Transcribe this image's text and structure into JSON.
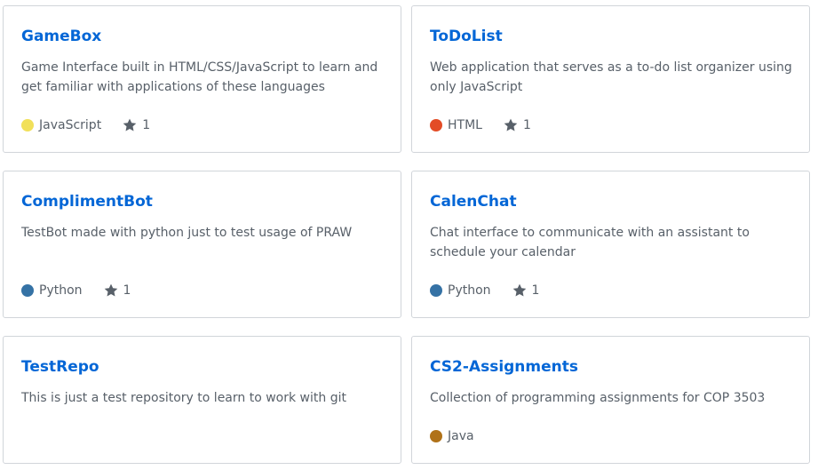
{
  "repos": [
    {
      "name": "GameBox",
      "description": "Game Interface built in HTML/CSS/JavaScript to learn and get familiar with applications of these languages",
      "language": "JavaScript",
      "language_color": "#f1e05a",
      "stars": "1"
    },
    {
      "name": "ToDoList",
      "description": "Web application that serves as a to-do list organizer using only JavaScript",
      "language": "HTML",
      "language_color": "#e34c26",
      "stars": "1"
    },
    {
      "name": "ComplimentBot",
      "description": "TestBot made with python just to test usage of PRAW",
      "language": "Python",
      "language_color": "#3572A5",
      "stars": "1"
    },
    {
      "name": "CalenChat",
      "description": "Chat interface to communicate with an assistant to schedule your calendar",
      "language": "Python",
      "language_color": "#3572A5",
      "stars": "1"
    },
    {
      "name": "TestRepo",
      "description": "This is just a test repository to learn to work with git",
      "language": "",
      "language_color": "",
      "stars": ""
    },
    {
      "name": "CS2-Assignments",
      "description": "Collection of programming assignments for COP 3503",
      "language": "Java",
      "language_color": "#b07219",
      "stars": ""
    }
  ],
  "icons": {
    "star": "star-icon"
  }
}
